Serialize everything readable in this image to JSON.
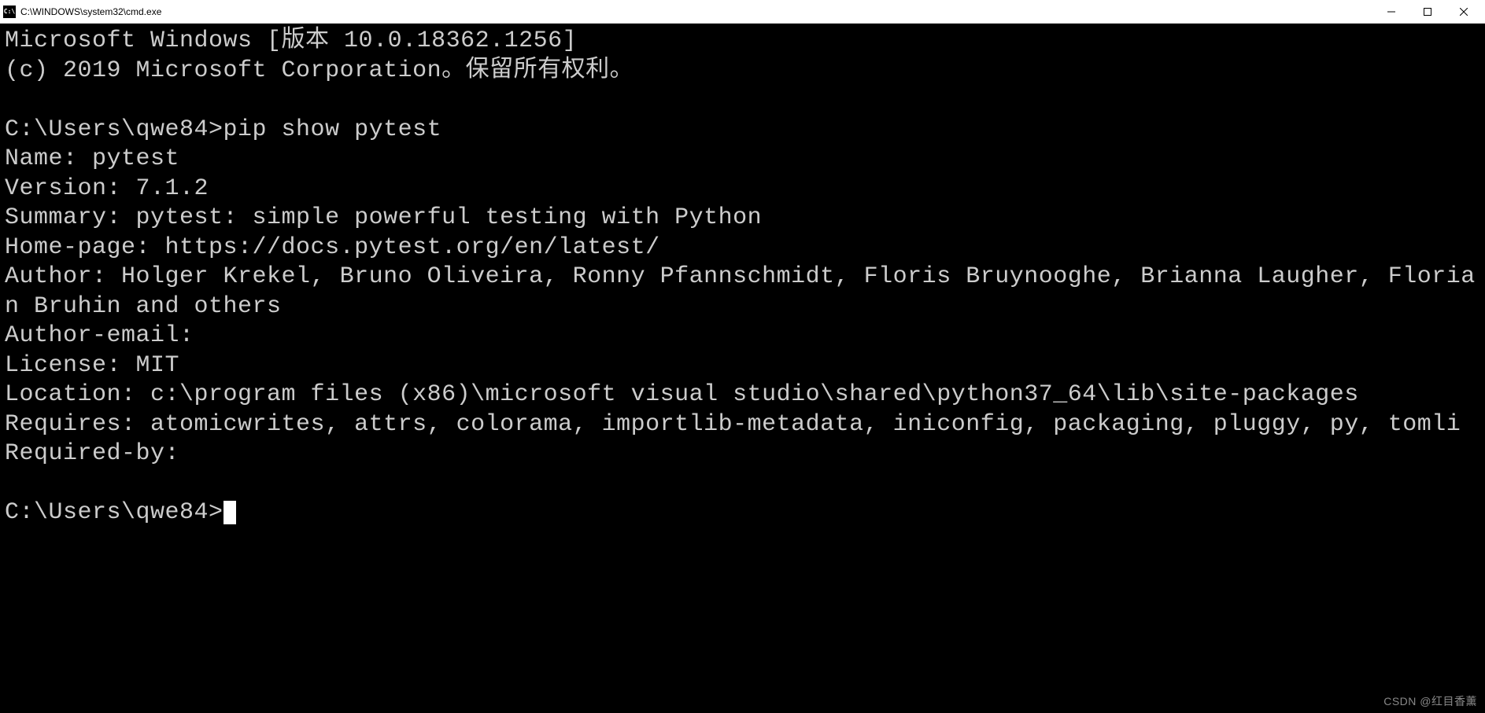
{
  "window": {
    "icon_text": "C:\\",
    "title": "C:\\WINDOWS\\system32\\cmd.exe"
  },
  "terminal": {
    "line1": "Microsoft Windows [版本 10.0.18362.1256]",
    "line2": "(c) 2019 Microsoft Corporation。保留所有权利。",
    "blank1": "",
    "prompt1": "C:\\Users\\qwe84>pip show pytest",
    "name": "Name: pytest",
    "version": "Version: 7.1.2",
    "summary": "Summary: pytest: simple powerful testing with Python",
    "homepage": "Home-page: https://docs.pytest.org/en/latest/",
    "author": "Author: Holger Krekel, Bruno Oliveira, Ronny Pfannschmidt, Floris Bruynooghe, Brianna Laugher, Florian Bruhin and others",
    "author_email": "Author-email:",
    "license": "License: MIT",
    "location": "Location: c:\\program files (x86)\\microsoft visual studio\\shared\\python37_64\\lib\\site-packages",
    "requires": "Requires: atomicwrites, attrs, colorama, importlib-metadata, iniconfig, packaging, pluggy, py, tomli",
    "required_by": "Required-by:",
    "blank2": "",
    "prompt2": "C:\\Users\\qwe84>"
  },
  "watermark": "CSDN @红目香薰"
}
